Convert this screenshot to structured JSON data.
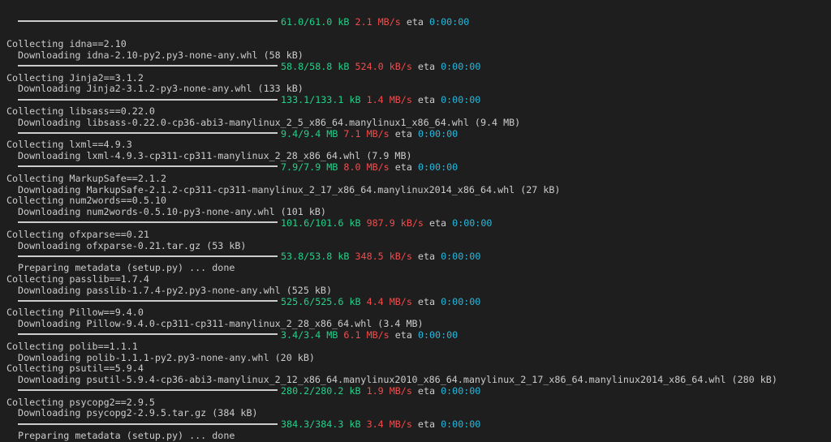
{
  "colors": {
    "background": "#1e1e1e",
    "text": "#cccccc",
    "size": "#23d18b",
    "speed": "#f14c4c",
    "eta": "#29b8db"
  },
  "top_partial": {
    "size": "61.0/61.0 kB",
    "speed": "2.1 MB/s",
    "eta_label": "eta",
    "eta": "0:00:00"
  },
  "lines": [
    {
      "type": "collect",
      "text": "Collecting idna==2.10"
    },
    {
      "type": "download",
      "text": "Downloading idna-2.10-py2.py3-none-any.whl (58 kB)"
    },
    {
      "type": "progress",
      "fraction": 1,
      "size": "58.8/58.8 kB",
      "speed": "524.0 kB/s",
      "eta_label": "eta",
      "eta": "0:00:00"
    },
    {
      "type": "collect",
      "text": "Collecting Jinja2==3.1.2"
    },
    {
      "type": "download",
      "text": "Downloading Jinja2-3.1.2-py3-none-any.whl (133 kB)"
    },
    {
      "type": "progress",
      "fraction": 1,
      "size": "133.1/133.1 kB",
      "speed": "1.4 MB/s",
      "eta_label": "eta",
      "eta": "0:00:00"
    },
    {
      "type": "collect",
      "text": "Collecting libsass==0.22.0"
    },
    {
      "type": "download",
      "text": "Downloading libsass-0.22.0-cp36-abi3-manylinux_2_5_x86_64.manylinux1_x86_64.whl (9.4 MB)"
    },
    {
      "type": "progress",
      "fraction": 1,
      "size": "9.4/9.4 MB",
      "speed": "7.1 MB/s",
      "eta_label": "eta",
      "eta": "0:00:00"
    },
    {
      "type": "collect",
      "text": "Collecting lxml==4.9.3"
    },
    {
      "type": "download",
      "text": "Downloading lxml-4.9.3-cp311-cp311-manylinux_2_28_x86_64.whl (7.9 MB)"
    },
    {
      "type": "progress",
      "fraction": 1,
      "size": "7.9/7.9 MB",
      "speed": "8.0 MB/s",
      "eta_label": "eta",
      "eta": "0:00:00"
    },
    {
      "type": "collect",
      "text": "Collecting MarkupSafe==2.1.2"
    },
    {
      "type": "download",
      "text": "Downloading MarkupSafe-2.1.2-cp311-cp311-manylinux_2_17_x86_64.manylinux2014_x86_64.whl (27 kB)"
    },
    {
      "type": "collect",
      "text": "Collecting num2words==0.5.10"
    },
    {
      "type": "download",
      "text": "Downloading num2words-0.5.10-py3-none-any.whl (101 kB)"
    },
    {
      "type": "progress",
      "fraction": 1,
      "size": "101.6/101.6 kB",
      "speed": "987.9 kB/s",
      "eta_label": "eta",
      "eta": "0:00:00"
    },
    {
      "type": "collect",
      "text": "Collecting ofxparse==0.21"
    },
    {
      "type": "download",
      "text": "Downloading ofxparse-0.21.tar.gz (53 kB)"
    },
    {
      "type": "progress",
      "fraction": 1,
      "size": "53.8/53.8 kB",
      "speed": "348.5 kB/s",
      "eta_label": "eta",
      "eta": "0:00:00"
    },
    {
      "type": "download",
      "text": "Preparing metadata (setup.py) ... done"
    },
    {
      "type": "collect",
      "text": "Collecting passlib==1.7.4"
    },
    {
      "type": "download",
      "text": "Downloading passlib-1.7.4-py2.py3-none-any.whl (525 kB)"
    },
    {
      "type": "progress",
      "fraction": 1,
      "size": "525.6/525.6 kB",
      "speed": "4.4 MB/s",
      "eta_label": "eta",
      "eta": "0:00:00"
    },
    {
      "type": "collect",
      "text": "Collecting Pillow==9.4.0"
    },
    {
      "type": "download",
      "text": "Downloading Pillow-9.4.0-cp311-cp311-manylinux_2_28_x86_64.whl (3.4 MB)"
    },
    {
      "type": "progress",
      "fraction": 1,
      "size": "3.4/3.4 MB",
      "speed": "6.1 MB/s",
      "eta_label": "eta",
      "eta": "0:00:00"
    },
    {
      "type": "collect",
      "text": "Collecting polib==1.1.1"
    },
    {
      "type": "download",
      "text": "Downloading polib-1.1.1-py2.py3-none-any.whl (20 kB)"
    },
    {
      "type": "collect",
      "text": "Collecting psutil==5.9.4"
    },
    {
      "type": "download",
      "text": "Downloading psutil-5.9.4-cp36-abi3-manylinux_2_12_x86_64.manylinux2010_x86_64.manylinux_2_17_x86_64.manylinux2014_x86_64.whl (280 kB)"
    },
    {
      "type": "progress",
      "fraction": 1,
      "size": "280.2/280.2 kB",
      "speed": "1.9 MB/s",
      "eta_label": "eta",
      "eta": "0:00:00"
    },
    {
      "type": "collect",
      "text": "Collecting psycopg2==2.9.5"
    },
    {
      "type": "download",
      "text": "Downloading psycopg2-2.9.5.tar.gz (384 kB)"
    },
    {
      "type": "progress",
      "fraction": 1,
      "size": "384.3/384.3 kB",
      "speed": "3.4 MB/s",
      "eta_label": "eta",
      "eta": "0:00:00"
    },
    {
      "type": "download",
      "text": "Preparing metadata (setup.py) ... done"
    }
  ]
}
